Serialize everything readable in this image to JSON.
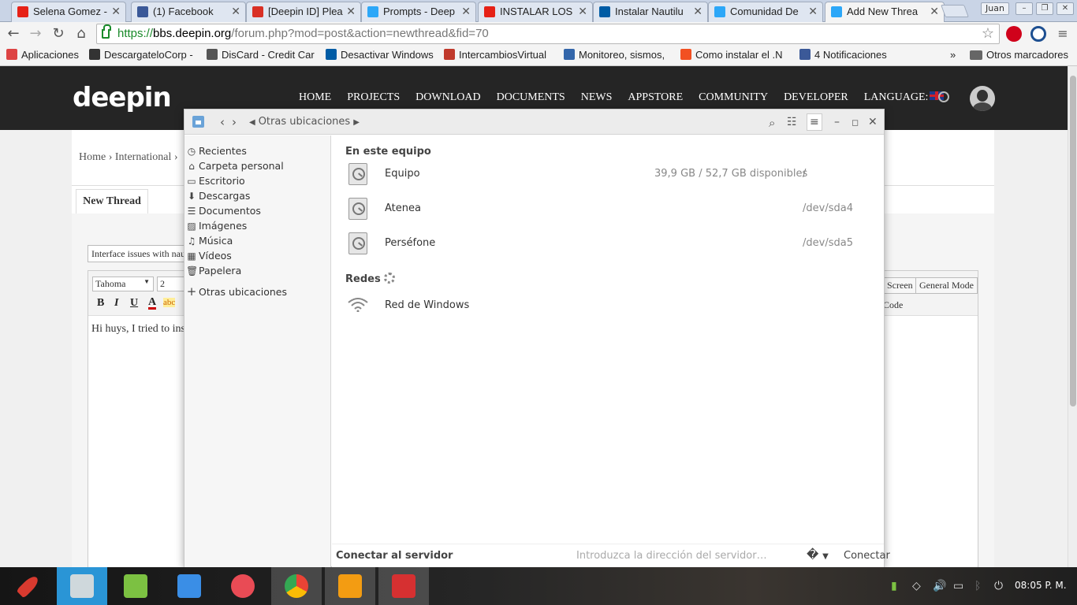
{
  "browser": {
    "tabs": [
      {
        "title": "Selena Gomez -",
        "icon": "youtube-icon",
        "color": "#e62117"
      },
      {
        "title": "(1) Facebook",
        "icon": "facebook-icon",
        "color": "#3b5998"
      },
      {
        "title": "[Deepin ID] Plea",
        "icon": "gmail-icon",
        "color": "#d93025"
      },
      {
        "title": "Prompts - Deep",
        "icon": "deepin-icon",
        "color": "#2ca7f8"
      },
      {
        "title": "INSTALAR LOS E",
        "icon": "youtube-icon",
        "color": "#e62117"
      },
      {
        "title": "Instalar Nautilu",
        "icon": "taringa-icon",
        "color": "#005ca5"
      },
      {
        "title": "Comunidad De",
        "icon": "deepin-icon",
        "color": "#2ca7f8"
      },
      {
        "title": "Add New Threa",
        "icon": "deepin-icon",
        "color": "#2ca7f8"
      }
    ],
    "profile": "Juan",
    "url": {
      "scheme": "https://",
      "host": "bbs.deepin.org",
      "path": "/forum.php?mod=post&action=newthread&fid=70"
    },
    "bookmarks": [
      {
        "label": "Aplicaciones",
        "icon": "apps-grid-icon",
        "color": "#d44"
      },
      {
        "label": "DescargateloCorp -",
        "icon": "dc-icon",
        "color": "#333"
      },
      {
        "label": "DisCard - Credit Car",
        "icon": "discard-icon",
        "color": "#555"
      },
      {
        "label": "Desactivar Windows",
        "icon": "taringa-icon",
        "color": "#005ca5"
      },
      {
        "label": "IntercambiosVirtual",
        "icon": "iv-icon",
        "color": "#c0392b"
      },
      {
        "label": "Monitoreo, sismos,",
        "icon": "globe-icon",
        "color": "#3366aa"
      },
      {
        "label": "Como instalar el .N",
        "icon": "microsoft-icon",
        "color": "#f25022"
      },
      {
        "label": "4 Notificaciones",
        "icon": "facebook-icon",
        "color": "#3b5998"
      }
    ],
    "bookmarks_more": "»",
    "other_bookmarks": "Otros marcadores"
  },
  "site": {
    "logo": "deepin",
    "nav": [
      "HOME",
      "PROJECTS",
      "DOWNLOAD",
      "DOCUMENTS",
      "NEWS",
      "APPSTORE",
      "COMMUNITY",
      "DEVELOPER",
      "LANGUAGE:"
    ],
    "breadcrumb": [
      "Home",
      "International"
    ],
    "breadcrumb_sep": "›",
    "tab_label": "New Thread",
    "subject": "Interface issues with nau",
    "editor": {
      "font": "Tahoma",
      "size": "2",
      "fmt_buttons": [
        "B",
        "I",
        "U",
        "A",
        "abc"
      ],
      "fullscreen": "Screen",
      "general_mode": "General Mode",
      "code_label": "Code",
      "body": "Hi huys, I tried to ins"
    }
  },
  "nautilus": {
    "path": "Otras ubicaciones",
    "sidebar": [
      {
        "label": "Recientes",
        "icon": "clock-icon",
        "glyph": "◷"
      },
      {
        "label": "Carpeta personal",
        "icon": "home-icon",
        "glyph": "⌂"
      },
      {
        "label": "Escritorio",
        "icon": "desktop-icon",
        "glyph": "▭"
      },
      {
        "label": "Descargas",
        "icon": "download-icon",
        "glyph": "⬇"
      },
      {
        "label": "Documentos",
        "icon": "document-icon",
        "glyph": "☰"
      },
      {
        "label": "Imágenes",
        "icon": "image-icon",
        "glyph": "▨"
      },
      {
        "label": "Música",
        "icon": "music-icon",
        "glyph": "♫"
      },
      {
        "label": "Vídeos",
        "icon": "video-icon",
        "glyph": "▦"
      },
      {
        "label": "Papelera",
        "icon": "trash-icon",
        "glyph": "🗑"
      }
    ],
    "other_locations": "Otras ubicaciones",
    "section_this_computer": "En este equipo",
    "drives": [
      {
        "name": "Equipo",
        "info": "39,9 GB / 52,7 GB disponibles",
        "path": "/"
      },
      {
        "name": "Atenea",
        "info": "",
        "path": "/dev/sda4"
      },
      {
        "name": "Perséfone",
        "info": "",
        "path": "/dev/sda5"
      }
    ],
    "section_networks": "Redes",
    "networks": [
      {
        "name": "Red de Windows"
      }
    ],
    "footer": {
      "label": "Conectar al servidor",
      "placeholder": "Introduzca la dirección del servidor…",
      "connect": "Conectar"
    }
  },
  "taskbar": {
    "apps": [
      {
        "icon": "launcher-rocket-icon",
        "color": "#d83a2f"
      },
      {
        "icon": "file-manager-icon",
        "color": "#cfd8dc"
      },
      {
        "icon": "app-store-icon",
        "color": "#7cc142"
      },
      {
        "icon": "video-player-icon",
        "color": "#3a8ee6"
      },
      {
        "icon": "system-settings-icon",
        "color": "#e94b55"
      },
      {
        "icon": "chrome-icon",
        "color": "#4285f4"
      },
      {
        "icon": "music-player-icon",
        "color": "#f39c12"
      },
      {
        "icon": "terminal-icon",
        "color": "#d63031"
      }
    ],
    "clock": "08:05 P. M."
  }
}
